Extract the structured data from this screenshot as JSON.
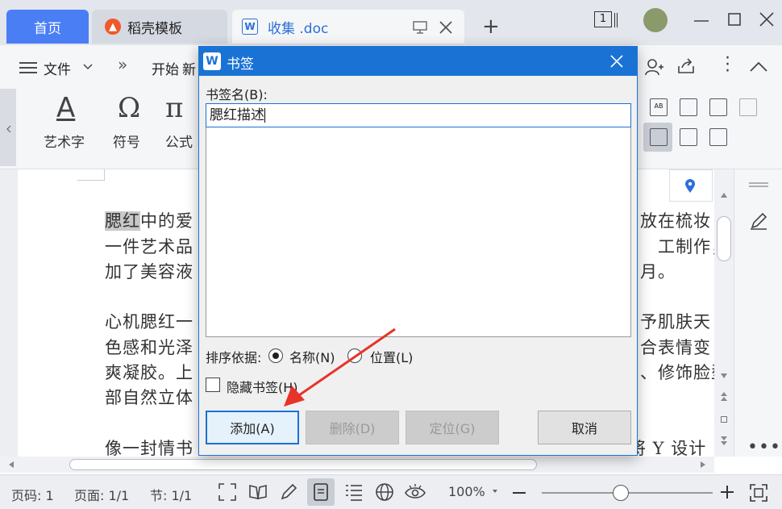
{
  "tabs": {
    "home": "首页",
    "template": "稻壳模板",
    "document": "收集 .doc",
    "new_tab": "+",
    "page_count_badge": "1"
  },
  "menu": {
    "file": "文件",
    "more": "»",
    "start": "开始",
    "new_partial": "新"
  },
  "ribbon": {
    "wordart": "艺术字",
    "symbol": "符号",
    "formula": "公式"
  },
  "document": {
    "lines": [
      {
        "hl": "腮红",
        "left": "中的爱",
        "right": "放在梳妆"
      },
      {
        "hl": "",
        "left": "一件艺术品",
        "right": "工制作，"
      },
      {
        "hl": "",
        "left": "加了美容液",
        "right": "月。"
      },
      {
        "hl": "",
        "left": "心机腮红一",
        "right": "予肌肤天"
      },
      {
        "hl": "",
        "left": "色感和光泽",
        "right": "合表情变"
      },
      {
        "hl": "",
        "left": "爽凝胶。上",
        "right": "、修饰脸型"
      },
      {
        "hl": "",
        "left": "部自然立体",
        "right": ""
      },
      {
        "hl": "",
        "left": "像一封情书",
        "right": "将 Y 设计"
      }
    ]
  },
  "dialog": {
    "title": "书签",
    "name_label": "书签名(B):",
    "name_value": "腮红描述",
    "sort_label": "排序依据:",
    "sort_by_name": "名称(N)",
    "sort_by_position": "位置(L)",
    "hidden_bookmarks": "隐藏书签(H)",
    "add": "添加(A)",
    "delete": "删除(D)",
    "locate": "定位(G)",
    "cancel": "取消"
  },
  "status": {
    "page_no": "页码: 1",
    "page": "页面: 1/1",
    "section": "节: 1/1",
    "zoom": "100%"
  },
  "colors": {
    "accent": "#1a73d4",
    "home_tab": "#4a7ef5",
    "arrow": "#e8332a"
  }
}
